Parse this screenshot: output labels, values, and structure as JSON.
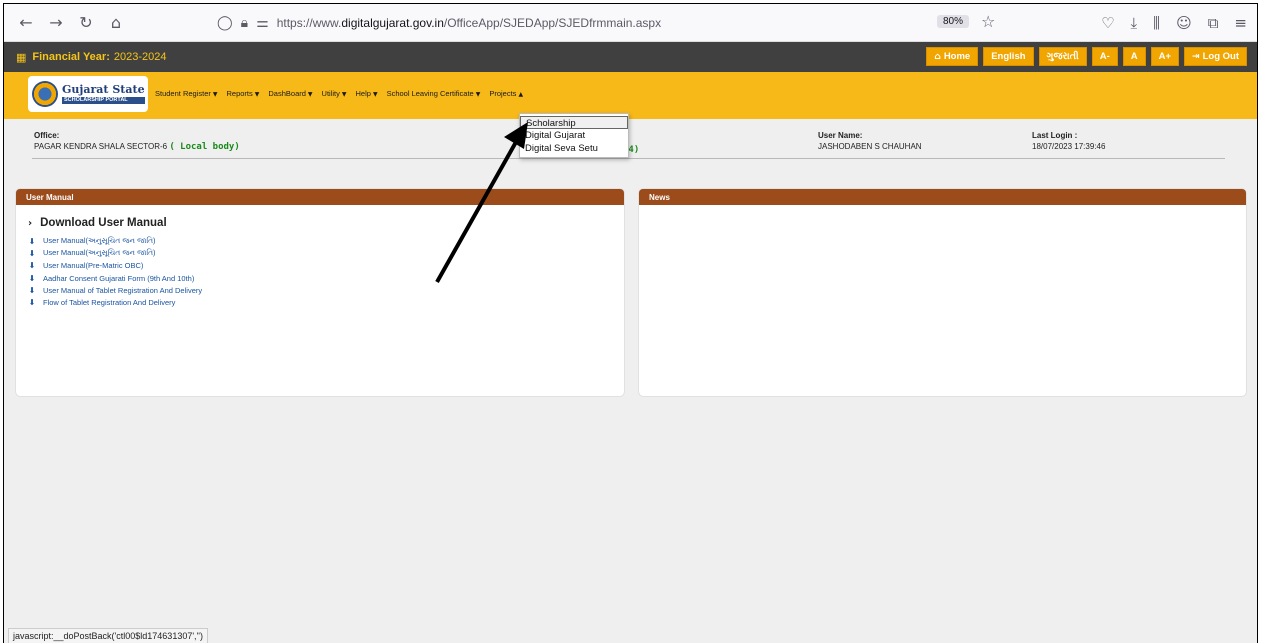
{
  "browser": {
    "url_prefix": "https://www.",
    "url_domain": "digitalgujarat.gov.in",
    "url_path": "/OfficeApp/SJEDApp/SJEDfrmmain.aspx",
    "zoom": "80%"
  },
  "topbar": {
    "fy_label": "Financial Year:",
    "fy_value": "2023-2024",
    "buttons": [
      {
        "label": "Home",
        "icon": "home-icon"
      },
      {
        "label": "English"
      },
      {
        "label": "ગુજરાતી"
      },
      {
        "label": "A-"
      },
      {
        "label": "A"
      },
      {
        "label": "A+"
      },
      {
        "label": "Log Out",
        "icon": "logout-icon"
      }
    ]
  },
  "logo": {
    "title": "Gujarat State",
    "subtitle": "SCHOLARSHIP PORTAL"
  },
  "menu": {
    "items": [
      "Student Register",
      "Reports",
      "DashBoard",
      "Utility",
      "Help",
      "School Leaving Certificate",
      "Projects"
    ]
  },
  "info": {
    "office_label": "Office:",
    "office_value": "PAGAR KENDRA SHALA SECTOR-6",
    "office_type": "( Local body)",
    "partial_code": ")4)",
    "user_label": "User Name:",
    "user_value": "JASHODABEN S CHAUHAN",
    "login_label": "Last Login :",
    "login_value": "18/07/2023 17:39:46"
  },
  "dropdown": {
    "items": [
      "Scholarship",
      "Digital Gujarat",
      "Digital Seva Setu"
    ]
  },
  "user_manual": {
    "header": "User Manual",
    "title": "Download User Manual",
    "links": [
      "User Manual(અનુસૂચિત જન જાતિ)",
      "User Manual(અનુસૂચિત જન જાતિ)",
      "User Manual(Pre-Matric OBC)",
      "Aadhar Consent Gujarati Form (9th And 10th)",
      "User Manual of Tablet Registration And Delivery",
      "Flow of Tablet Registration And Delivery"
    ]
  },
  "news": {
    "header": "News"
  },
  "status_bar": {
    "text": "javascript:__doPostBack('ctl00$ld174631307','')"
  }
}
